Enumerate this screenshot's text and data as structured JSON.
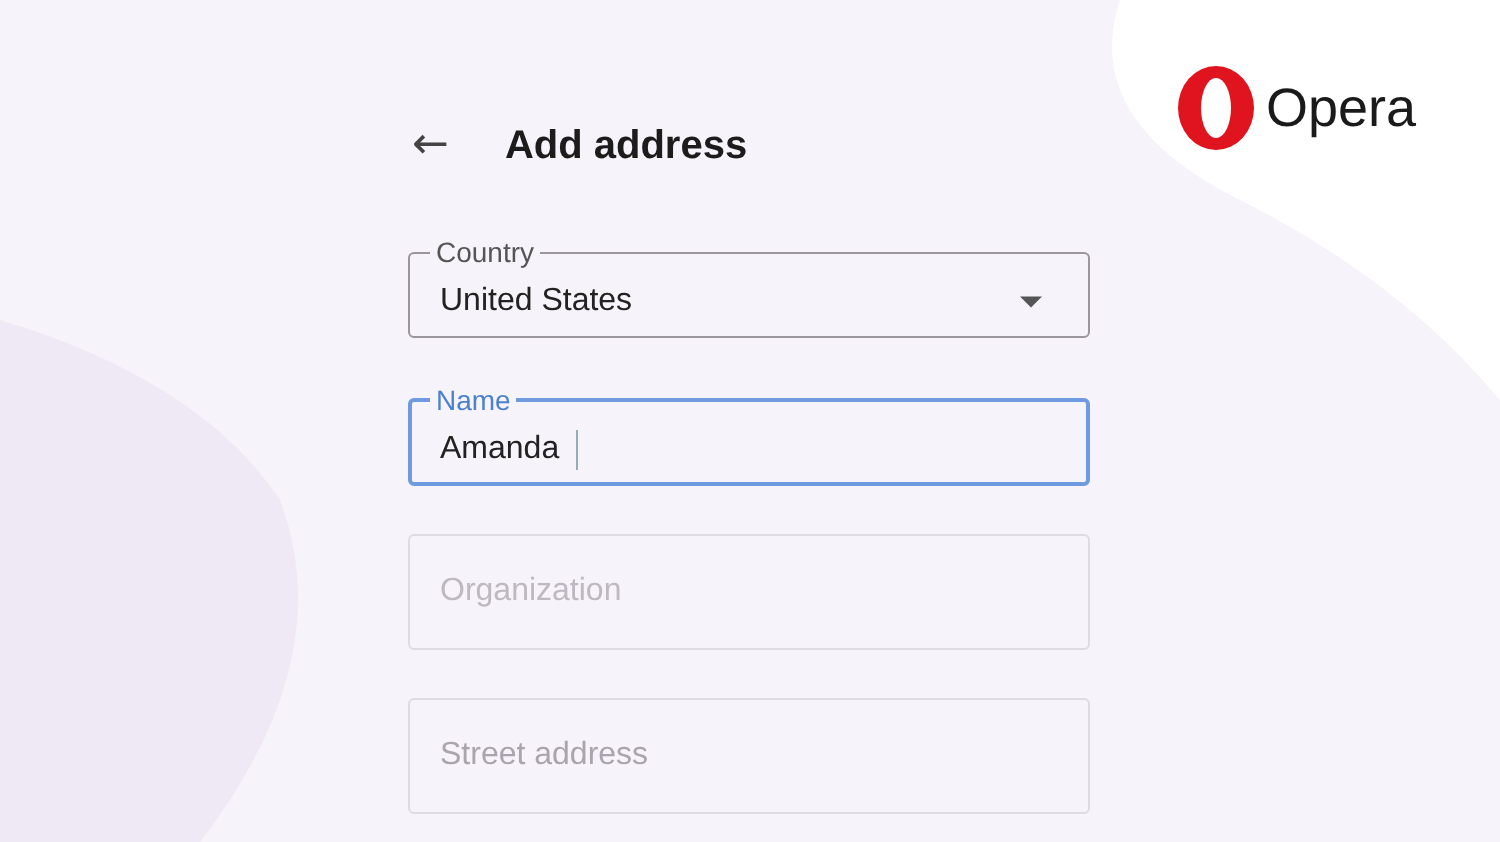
{
  "brand": {
    "name": "Opera"
  },
  "header": {
    "back": "←",
    "title": "Add address"
  },
  "fields": [
    {
      "kind": "select",
      "label": "Country",
      "value": "United States",
      "focused": false
    },
    {
      "kind": "text",
      "label": "Name",
      "value": "Amanda",
      "focused": true
    },
    {
      "kind": "text",
      "placeholder": "Organization",
      "focused": false
    },
    {
      "kind": "text",
      "placeholder": "Street address",
      "focused": false
    }
  ]
}
